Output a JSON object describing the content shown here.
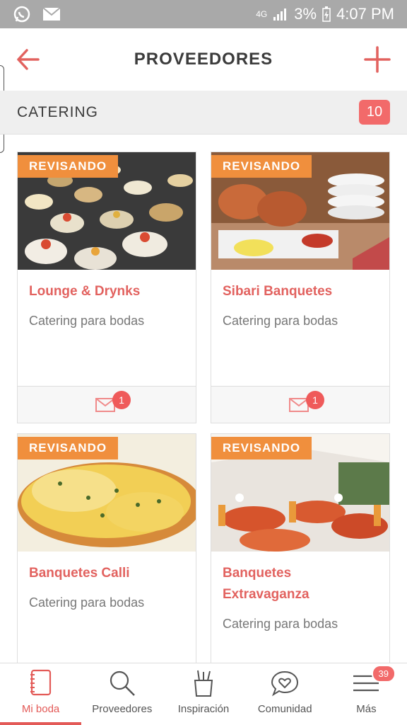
{
  "statusbar": {
    "network": "4G",
    "battery": "3%",
    "time": "4:07 PM",
    "icons": [
      "whatsapp-icon",
      "mail-icon",
      "signal-icon",
      "battery-icon"
    ]
  },
  "appbar": {
    "title": "PROVEEDORES",
    "accent": "#e2625f"
  },
  "section": {
    "title": "CATERING",
    "count": "10"
  },
  "cards": [
    {
      "tag": "REVISANDO",
      "title": "Lounge & Drynks",
      "subtitle": "Catering para bodas",
      "messages": "1"
    },
    {
      "tag": "REVISANDO",
      "title": "Sibari Banquetes",
      "subtitle": "Catering para bodas",
      "messages": "1"
    },
    {
      "tag": "REVISANDO",
      "title": "Banquetes Calli",
      "subtitle": "Catering para bodas"
    },
    {
      "tag": "REVISANDO",
      "title": "Banquetes Extravaganza",
      "subtitle": "Catering para bodas"
    }
  ],
  "nav": {
    "items": [
      {
        "label": "Mi boda",
        "icon": "notebook-icon"
      },
      {
        "label": "Proveedores",
        "icon": "search-icon"
      },
      {
        "label": "Inspiración",
        "icon": "pencil-cup-icon"
      },
      {
        "label": "Comunidad",
        "icon": "chat-heart-icon"
      },
      {
        "label": "Más",
        "icon": "menu-icon"
      }
    ],
    "more_badge": "39"
  },
  "colors": {
    "accent": "#e2625f",
    "tag": "#f08f3d",
    "statusbar": "#a9a9a9"
  }
}
